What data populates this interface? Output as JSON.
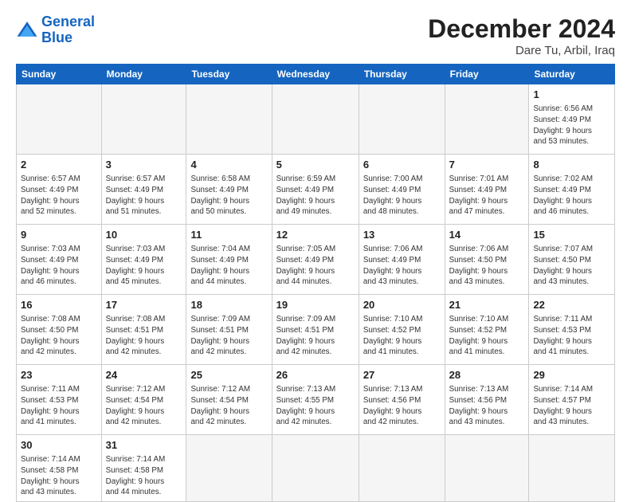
{
  "logo": {
    "line1": "General",
    "line2": "Blue"
  },
  "title": "December 2024",
  "location": "Dare Tu, Arbil, Iraq",
  "weekdays": [
    "Sunday",
    "Monday",
    "Tuesday",
    "Wednesday",
    "Thursday",
    "Friday",
    "Saturday"
  ],
  "days": [
    {
      "num": "",
      "info": ""
    },
    {
      "num": "",
      "info": ""
    },
    {
      "num": "",
      "info": ""
    },
    {
      "num": "",
      "info": ""
    },
    {
      "num": "",
      "info": ""
    },
    {
      "num": "",
      "info": ""
    },
    {
      "num": "1",
      "info": "Sunrise: 6:56 AM\nSunset: 4:49 PM\nDaylight: 9 hours\nand 53 minutes."
    },
    {
      "num": "2",
      "info": "Sunrise: 6:57 AM\nSunset: 4:49 PM\nDaylight: 9 hours\nand 52 minutes."
    },
    {
      "num": "3",
      "info": "Sunrise: 6:57 AM\nSunset: 4:49 PM\nDaylight: 9 hours\nand 51 minutes."
    },
    {
      "num": "4",
      "info": "Sunrise: 6:58 AM\nSunset: 4:49 PM\nDaylight: 9 hours\nand 50 minutes."
    },
    {
      "num": "5",
      "info": "Sunrise: 6:59 AM\nSunset: 4:49 PM\nDaylight: 9 hours\nand 49 minutes."
    },
    {
      "num": "6",
      "info": "Sunrise: 7:00 AM\nSunset: 4:49 PM\nDaylight: 9 hours\nand 48 minutes."
    },
    {
      "num": "7",
      "info": "Sunrise: 7:01 AM\nSunset: 4:49 PM\nDaylight: 9 hours\nand 47 minutes."
    },
    {
      "num": "8",
      "info": "Sunrise: 7:02 AM\nSunset: 4:49 PM\nDaylight: 9 hours\nand 46 minutes."
    },
    {
      "num": "9",
      "info": "Sunrise: 7:03 AM\nSunset: 4:49 PM\nDaylight: 9 hours\nand 46 minutes."
    },
    {
      "num": "10",
      "info": "Sunrise: 7:03 AM\nSunset: 4:49 PM\nDaylight: 9 hours\nand 45 minutes."
    },
    {
      "num": "11",
      "info": "Sunrise: 7:04 AM\nSunset: 4:49 PM\nDaylight: 9 hours\nand 44 minutes."
    },
    {
      "num": "12",
      "info": "Sunrise: 7:05 AM\nSunset: 4:49 PM\nDaylight: 9 hours\nand 44 minutes."
    },
    {
      "num": "13",
      "info": "Sunrise: 7:06 AM\nSunset: 4:49 PM\nDaylight: 9 hours\nand 43 minutes."
    },
    {
      "num": "14",
      "info": "Sunrise: 7:06 AM\nSunset: 4:50 PM\nDaylight: 9 hours\nand 43 minutes."
    },
    {
      "num": "15",
      "info": "Sunrise: 7:07 AM\nSunset: 4:50 PM\nDaylight: 9 hours\nand 43 minutes."
    },
    {
      "num": "16",
      "info": "Sunrise: 7:08 AM\nSunset: 4:50 PM\nDaylight: 9 hours\nand 42 minutes."
    },
    {
      "num": "17",
      "info": "Sunrise: 7:08 AM\nSunset: 4:51 PM\nDaylight: 9 hours\nand 42 minutes."
    },
    {
      "num": "18",
      "info": "Sunrise: 7:09 AM\nSunset: 4:51 PM\nDaylight: 9 hours\nand 42 minutes."
    },
    {
      "num": "19",
      "info": "Sunrise: 7:09 AM\nSunset: 4:51 PM\nDaylight: 9 hours\nand 42 minutes."
    },
    {
      "num": "20",
      "info": "Sunrise: 7:10 AM\nSunset: 4:52 PM\nDaylight: 9 hours\nand 41 minutes."
    },
    {
      "num": "21",
      "info": "Sunrise: 7:10 AM\nSunset: 4:52 PM\nDaylight: 9 hours\nand 41 minutes."
    },
    {
      "num": "22",
      "info": "Sunrise: 7:11 AM\nSunset: 4:53 PM\nDaylight: 9 hours\nand 41 minutes."
    },
    {
      "num": "23",
      "info": "Sunrise: 7:11 AM\nSunset: 4:53 PM\nDaylight: 9 hours\nand 41 minutes."
    },
    {
      "num": "24",
      "info": "Sunrise: 7:12 AM\nSunset: 4:54 PM\nDaylight: 9 hours\nand 42 minutes."
    },
    {
      "num": "25",
      "info": "Sunrise: 7:12 AM\nSunset: 4:54 PM\nDaylight: 9 hours\nand 42 minutes."
    },
    {
      "num": "26",
      "info": "Sunrise: 7:13 AM\nSunset: 4:55 PM\nDaylight: 9 hours\nand 42 minutes."
    },
    {
      "num": "27",
      "info": "Sunrise: 7:13 AM\nSunset: 4:56 PM\nDaylight: 9 hours\nand 42 minutes."
    },
    {
      "num": "28",
      "info": "Sunrise: 7:13 AM\nSunset: 4:56 PM\nDaylight: 9 hours\nand 43 minutes."
    },
    {
      "num": "29",
      "info": "Sunrise: 7:14 AM\nSunset: 4:57 PM\nDaylight: 9 hours\nand 43 minutes."
    },
    {
      "num": "30",
      "info": "Sunrise: 7:14 AM\nSunset: 4:58 PM\nDaylight: 9 hours\nand 43 minutes."
    },
    {
      "num": "31",
      "info": "Sunrise: 7:14 AM\nSunset: 4:58 PM\nDaylight: 9 hours\nand 44 minutes."
    },
    {
      "num": "",
      "info": ""
    },
    {
      "num": "",
      "info": ""
    },
    {
      "num": "",
      "info": ""
    },
    {
      "num": "",
      "info": ""
    },
    {
      "num": "",
      "info": ""
    }
  ]
}
